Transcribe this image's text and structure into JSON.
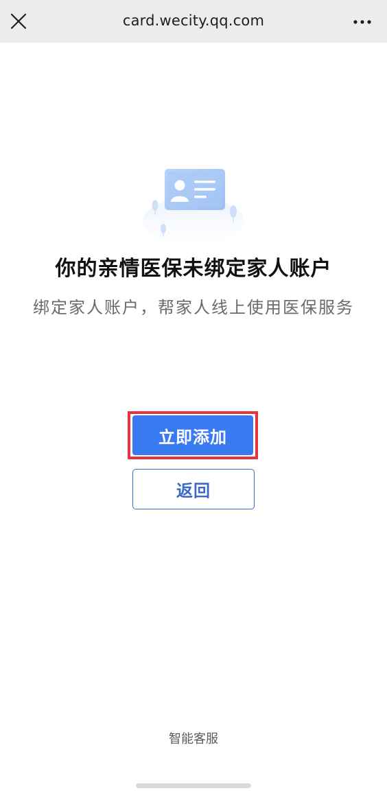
{
  "topbar": {
    "url": "card.wecity.qq.com",
    "close_icon": "close-icon",
    "more_icon": "more-horizontal-icon"
  },
  "main": {
    "illustration_icon": "id-card-illustration",
    "title": "你的亲情医保未绑定家人账户",
    "subtitle": "绑定家人账户，帮家人线上使用医保服务",
    "primary_button": "立即添加",
    "secondary_button": "返回"
  },
  "footer": {
    "service_link": "智能客服"
  },
  "colors": {
    "accent": "#3a7af0",
    "highlight_border": "#e5343b",
    "topbar_bg": "#ececec"
  }
}
